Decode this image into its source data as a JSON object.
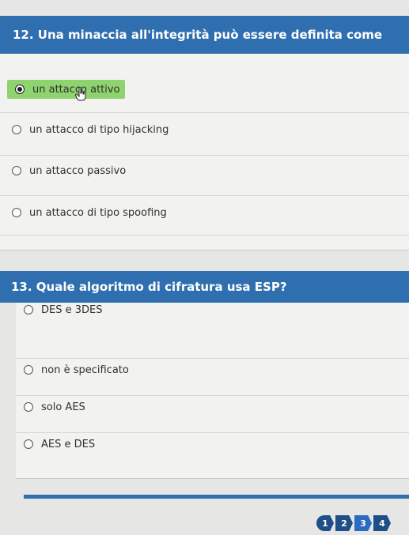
{
  "q12": {
    "title": "12. Una minaccia all'integrità può essere definita come",
    "options": [
      {
        "label": "un attacco attivo",
        "selected": true
      },
      {
        "label": "un attacco di tipo hijacking",
        "selected": false
      },
      {
        "label": "un attacco passivo",
        "selected": false
      },
      {
        "label": "un attacco di tipo spoofing",
        "selected": false
      }
    ]
  },
  "q13": {
    "title": "13. Quale algoritmo di cifratura usa ESP?",
    "options": [
      {
        "label": "DES e 3DES",
        "selected": false
      },
      {
        "label": "non è specificato",
        "selected": false
      },
      {
        "label": "solo AES",
        "selected": false
      },
      {
        "label": "AES e DES",
        "selected": false
      }
    ]
  },
  "pager": {
    "pages": [
      "1",
      "2",
      "3",
      "4"
    ],
    "current": "3"
  },
  "colors": {
    "header": "#2f6fb0",
    "selected_answer": "#8fd36f",
    "pager": "#1f4f86"
  },
  "icons": {
    "cursor": "hand-pointer-icon"
  }
}
